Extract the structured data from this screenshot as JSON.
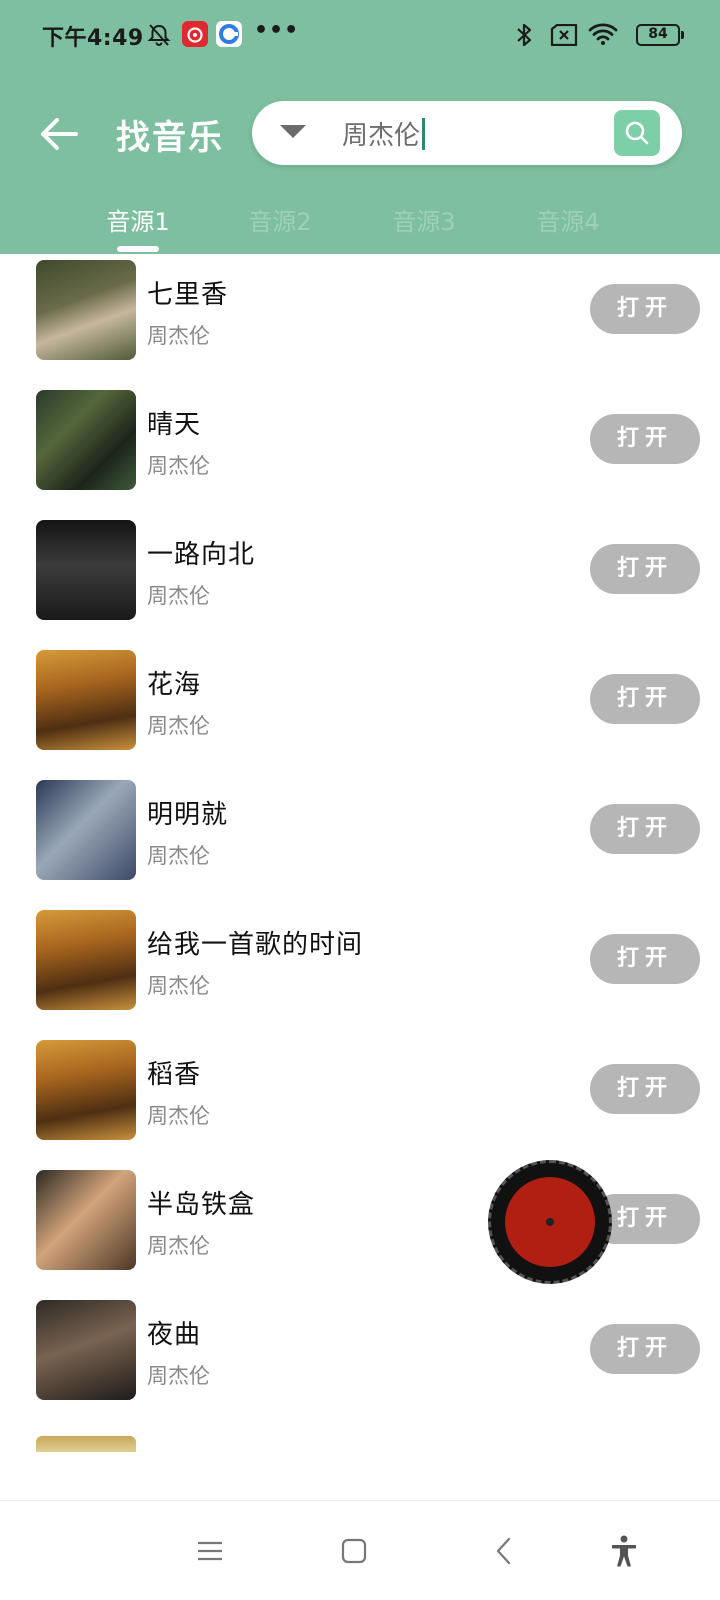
{
  "status_bar": {
    "time": "下午4:49",
    "battery": "84",
    "more": "•••"
  },
  "header": {
    "title": "找音乐",
    "search_value": "周杰伦"
  },
  "tabs": [
    "音源1",
    "音源2",
    "音源3",
    "音源4"
  ],
  "active_tab": 0,
  "songs": [
    {
      "title": "七里香",
      "artist": "周杰伦",
      "action": "打开"
    },
    {
      "title": "晴天",
      "artist": "周杰伦",
      "action": "打开"
    },
    {
      "title": "一路向北",
      "artist": "周杰伦",
      "action": "打开"
    },
    {
      "title": "花海",
      "artist": "周杰伦",
      "action": "打开"
    },
    {
      "title": "明明就",
      "artist": "周杰伦",
      "action": "打开"
    },
    {
      "title": "给我一首歌的时间",
      "artist": "周杰伦",
      "action": "打开"
    },
    {
      "title": "稻香",
      "artist": "周杰伦",
      "action": "打开"
    },
    {
      "title": "半岛铁盒",
      "artist": "周杰伦",
      "action": "打开"
    },
    {
      "title": "夜曲",
      "artist": "周杰伦",
      "action": "打开"
    }
  ],
  "colors": {
    "header_bg": "#7dbf9f",
    "open_button_bg": "#b6b6b6",
    "disc_red": "#b01f12"
  }
}
